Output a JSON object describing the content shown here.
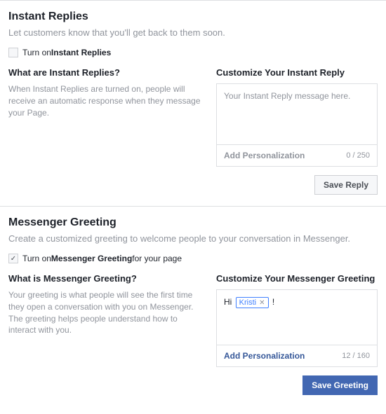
{
  "instantReplies": {
    "title": "Instant Replies",
    "desc": "Let customers know that you'll get back to them soon.",
    "toggle_pre": "Turn on ",
    "toggle_bold": "Instant Replies",
    "checked": false,
    "left_title": "What are Instant Replies?",
    "left_desc": "When Instant Replies are turned on, people will receive an automatic response when they message your Page.",
    "right_title": "Customize Your Instant Reply",
    "placeholder": "Your Instant Reply message here.",
    "add_personalization": "Add Personalization",
    "counter": "0 / 250",
    "save_label": "Save Reply"
  },
  "messengerGreeting": {
    "title": "Messenger Greeting",
    "desc": "Create a customized greeting to welcome people to your conversation in Messenger.",
    "toggle_pre": "Turn on ",
    "toggle_bold": "Messenger Greeting",
    "toggle_post": " for your page",
    "checked": true,
    "left_title": "What is Messenger Greeting?",
    "left_desc": "Your greeting is what people will see the first time they open a conversation with you on Messenger. The greeting helps people understand how to interact with you.",
    "right_title": "Customize Your Messenger Greeting",
    "greeting_pre": "Hi ",
    "token": "Kristi",
    "greeting_post": " !",
    "add_personalization": "Add Personalization",
    "counter": "12 / 160",
    "save_label": "Save Greeting"
  }
}
